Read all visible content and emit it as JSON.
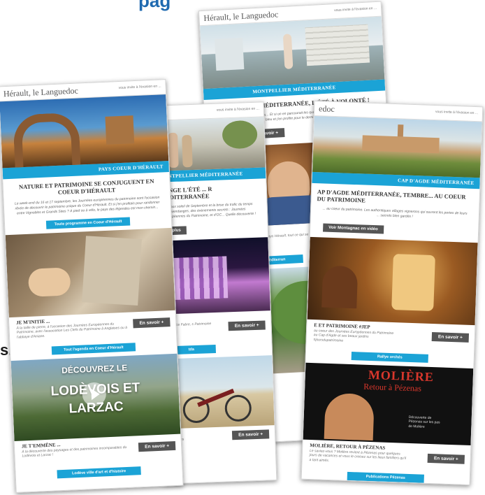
{
  "fragments": {
    "top_headline": "pag",
    "left_text": "s."
  },
  "brand": "Hérault, le Languedoc",
  "tagline": "vous invite à l'évasion en ...",
  "more_label": "En savoir +",
  "card1": {
    "band": "PAYS COEUR D'HÉRAULT",
    "title": "NATURE ET PATRIMOINE SE CONJUGUENT EN COEUR D'HÉRAULT",
    "body": "Le week-end du 16 et 17 septembre, les Journées européennes du patrimoine sont l'occasion rêvée de découvrir le patrimoine unique du Coeur d'Hérault. Et si j'en profitais pour randonner entre Vignobles et Grands Sites ? À pied ou à vélo, le pays des légendes est mon chemin...",
    "button": "Toute programme en Coeur d'Hérault",
    "row1_title": "JE M'INITIE ...",
    "row1_text": "À la taille de pierre, à l'occasion des Journées Européennes du Patrimoine, avec l'association Les Clefs du Patrimoine à Anglaises ou à l'abbaye d'Aniane.",
    "button2": "Tout l'agenda en Coeur d'Hérault",
    "video_line1": "DÉCOUVREZ LE",
    "video_line2": "LODÈVOIS ET",
    "video_line3": "LARZAC",
    "row2_title": "JE T'EMMÈNE ...",
    "row2_text": "À la découverte des paysages et des patrimoines incomparables du Lodévois et Larzac !",
    "button3": "Lodève ville d'art et d'histoire"
  },
  "card2": {
    "brand_frag": "c",
    "band": "MONTPELLIER MÉDITERRANÉE",
    "title": "LONGE L'ÉTÉ ... R MÉDITERRANÉE",
    "body": "le doux soleil de Septembre et la brise du trafic du temps des vendanges, des évènements secrets : Journées européennes du Patrimoine, et d'OC... Quelle découverte !",
    "button_frag": "ir plus",
    "row_text": "e France Fabre, s Patrimoine",
    "button2": "tda",
    "row2_text": "des rives"
  },
  "card3": {
    "band": "MONTPELLIER MÉDITERRANÉE",
    "title": "PELLIER MÉDITERRANÉE, L'ÉTÉ À VOLONTÉ !",
    "body": "Journées, animations... Et si on en parcourait les quais ! Tout l'été, des évènements en rade. Je flâne sous un ciel bleu et j'en profite pour le dernier, le plus long...",
    "button": "En savoir +",
    "row_text": "te terre de vin du pays Hérault, tout ce qui se fait à Montpellier",
    "button2": "des méditerran"
  },
  "card4": {
    "brand_frag": "edoc",
    "band": "CAP D'AGDE MÉDITERRANÉE",
    "title": "AP D'AGDE MÉDITERRANÉE, TEMBRE... AU COEUR DU PATRIMOINE",
    "body": "... au coeur du patrimoine. Les authentiques villages vignerons qui ouvrent les portes de leurs ... secrets bien gardés !",
    "button": "Voir Montagnac en vidéo",
    "row1_title": "E ET PATRIMOINE #JEP",
    "row1_text": "au coeur des Journées Européennes du Patrimoine au Cap d'Agde et ses beaux jardins #joursdupatrimoine",
    "button2": "Rallye orchés",
    "poster_title": "MOLIÈRE",
    "poster_sub": "Retour à Pézenas",
    "poster_caption": "Découverte de Pézenas sur les pas de Molière",
    "row2_title": "MOLIÈRE, RETOUR À PÉZENAS",
    "row2_text": "Le saviez-vous ? Molière revient à Pézenas pour quelques jours de vacances et vous le croisez sur les lieux familiers qu'il a tant aimés.",
    "button3": "Publications Pézenas"
  }
}
